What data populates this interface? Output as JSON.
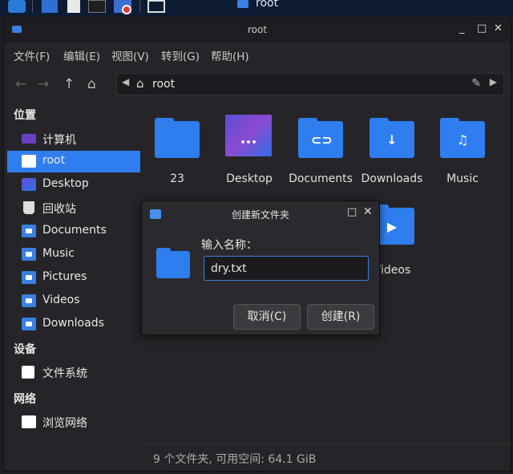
{
  "taskbar": {
    "active_window_title": "root"
  },
  "window": {
    "title": "root",
    "controls": {
      "minimize": "_",
      "maximize": "□",
      "close": "✕"
    }
  },
  "menu": [
    {
      "label": "文件(F)"
    },
    {
      "label": "编辑(E)"
    },
    {
      "label": "视图(V)"
    },
    {
      "label": "转到(G)"
    },
    {
      "label": "帮助(H)"
    }
  ],
  "toolbar": {
    "path_label": "root"
  },
  "sidebar": {
    "sections": {
      "places": "位置",
      "devices": "设备",
      "network": "网络"
    },
    "places": [
      {
        "label": "计算机",
        "icon": "computer-icon"
      },
      {
        "label": "root",
        "icon": "home-folder-icon",
        "active": true
      },
      {
        "label": "Desktop",
        "icon": "desktop-icon"
      },
      {
        "label": "回收站",
        "icon": "trash-icon"
      },
      {
        "label": "Documents",
        "icon": "documents-folder-icon"
      },
      {
        "label": "Music",
        "icon": "music-folder-icon"
      },
      {
        "label": "Pictures",
        "icon": "pictures-folder-icon"
      },
      {
        "label": "Videos",
        "icon": "videos-folder-icon"
      },
      {
        "label": "Downloads",
        "icon": "downloads-folder-icon"
      }
    ],
    "devices": [
      {
        "label": "文件系统",
        "icon": "drive-icon"
      }
    ],
    "network": [
      {
        "label": "浏览网络",
        "icon": "network-icon"
      }
    ]
  },
  "files": [
    {
      "label": "23",
      "icon": "folder-icon"
    },
    {
      "label": "Desktop",
      "icon": "desktop-folder-icon"
    },
    {
      "label": "Documents",
      "icon": "documents-folder-icon"
    },
    {
      "label": "Downloads",
      "icon": "downloads-folder-icon"
    },
    {
      "label": "Music",
      "icon": "music-folder-icon"
    },
    {
      "label": "Videos",
      "icon": "videos-folder-icon"
    }
  ],
  "status": {
    "text": "9 个文件夹, 可用空间: 64.1 GiB"
  },
  "dialog": {
    "title": "创建新文件夹",
    "prompt": "输入名称：",
    "input_value": "dry.txt",
    "cancel_label": "取消(C)",
    "create_label": "创建(R)"
  },
  "colors": {
    "accent": "#2f7ef0",
    "background": "#252529",
    "taskbar": "#0d1b33"
  }
}
